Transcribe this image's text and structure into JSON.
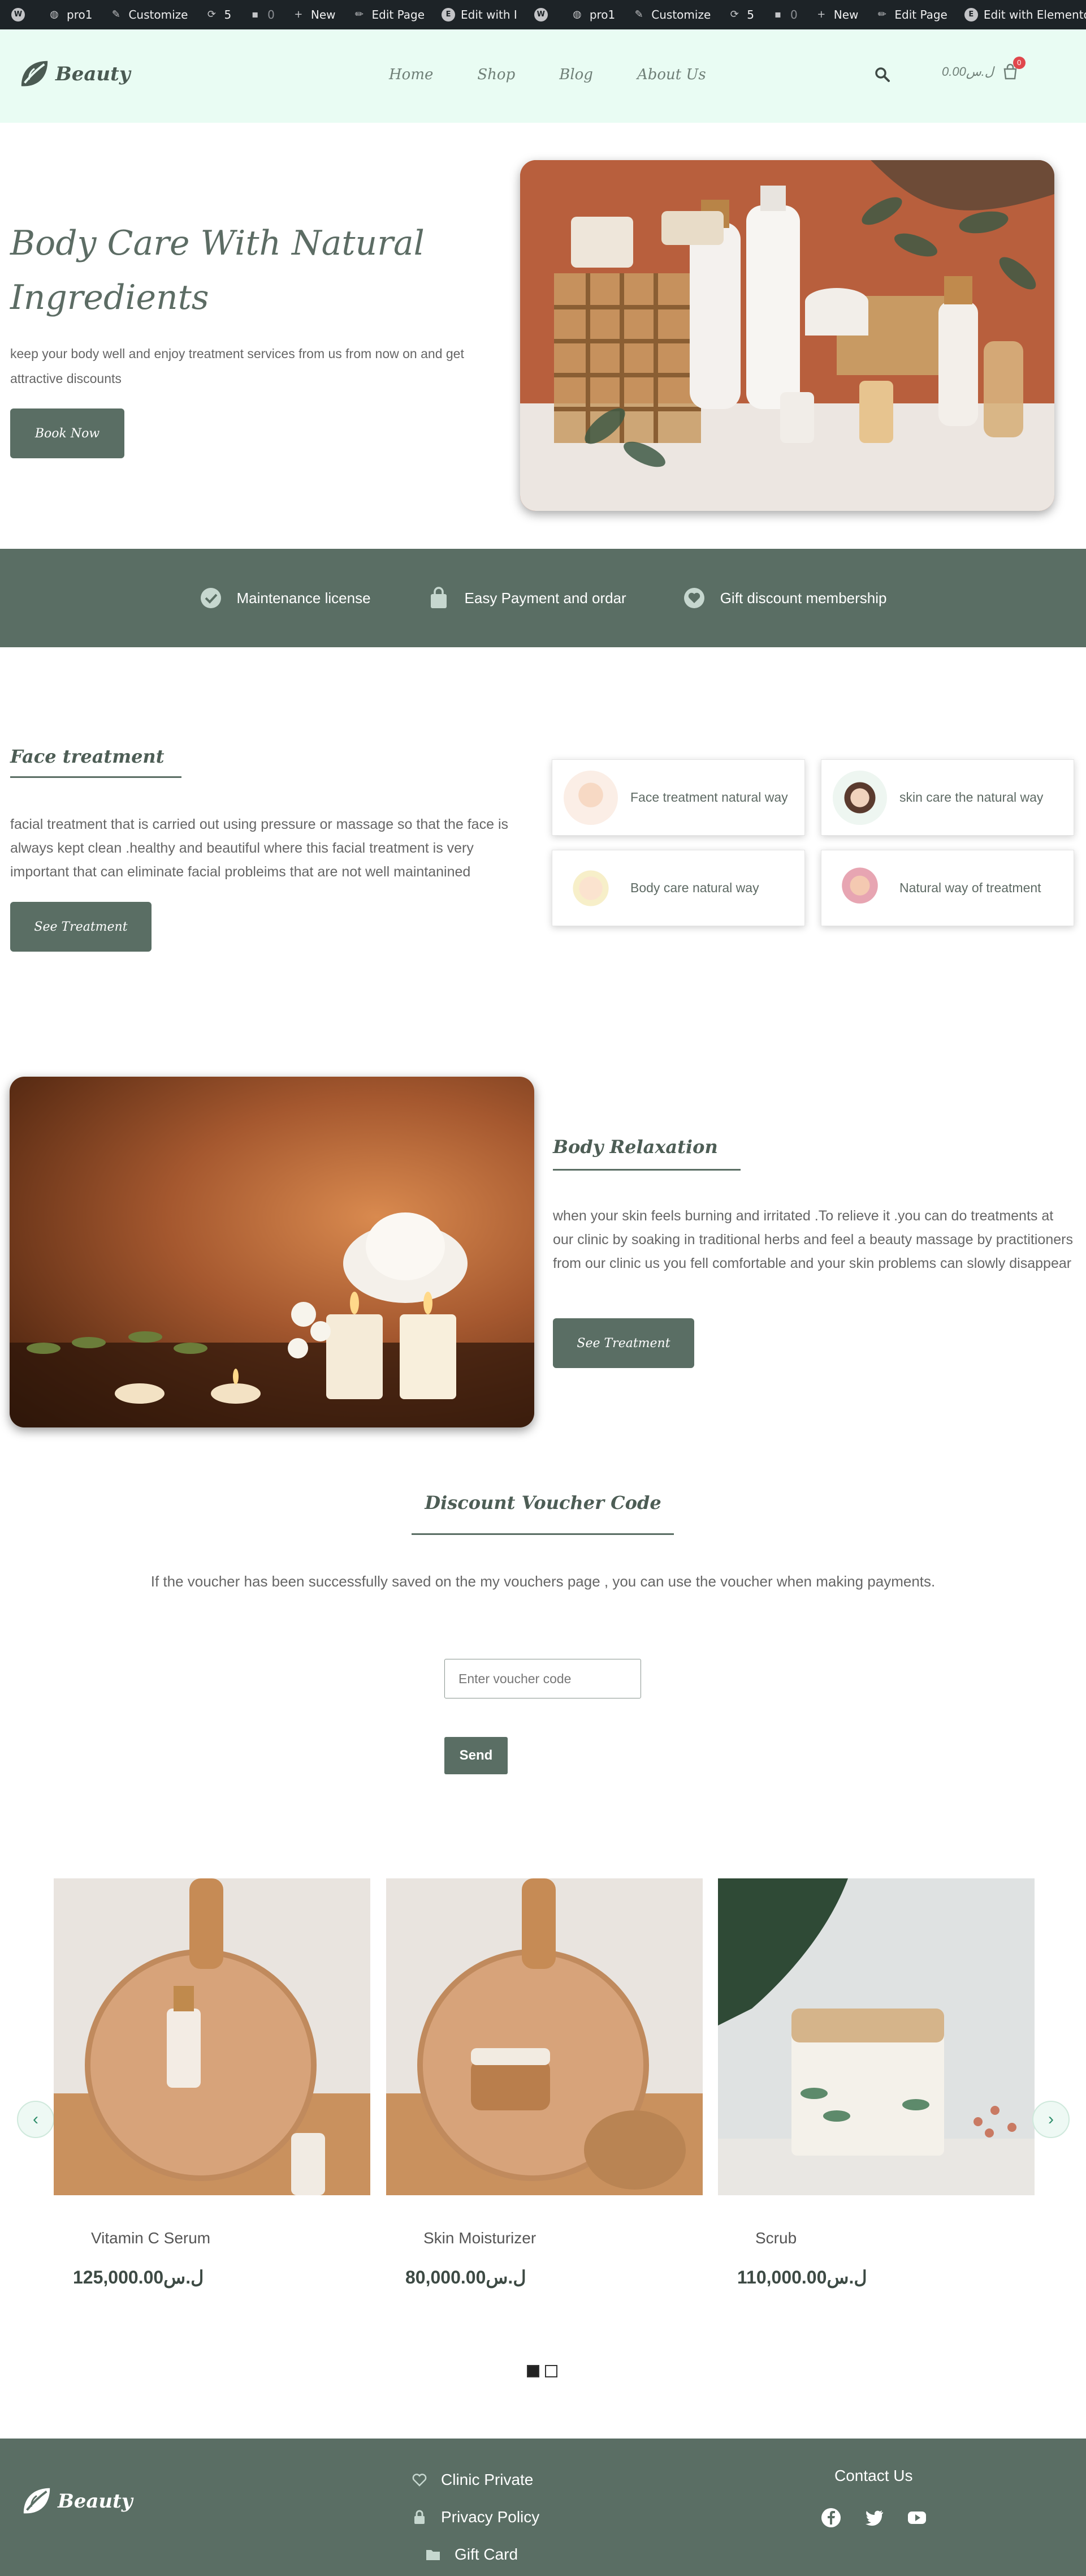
{
  "admin_bar": {
    "items": [
      {
        "icon": "wordpress-icon",
        "label": ""
      },
      {
        "icon": "dashboard-icon",
        "label": "pro1"
      },
      {
        "icon": "brush-icon",
        "label": "Customize"
      },
      {
        "icon": "updates-icon",
        "label": "5"
      },
      {
        "icon": "comment-icon",
        "label": "0"
      },
      {
        "icon": "plus-icon",
        "label": "New"
      },
      {
        "icon": "pencil-icon",
        "label": "Edit Page"
      },
      {
        "icon": "elementor-icon",
        "label": "Edit with I"
      },
      {
        "icon": "wordpress-icon",
        "label": ""
      },
      {
        "icon": "dashboard-icon",
        "label": "pro1"
      },
      {
        "icon": "brush-icon",
        "label": "Customize"
      },
      {
        "icon": "updates-icon",
        "label": "5"
      },
      {
        "icon": "comment-icon",
        "label": "0"
      },
      {
        "icon": "plus-icon",
        "label": "New"
      },
      {
        "icon": "pencil-icon",
        "label": "Edit Page"
      },
      {
        "icon": "elementor-icon",
        "label": "Edit with Elementor"
      }
    ]
  },
  "header": {
    "logo_text": "Beauty",
    "nav": [
      "Home",
      "Shop",
      "Blog",
      "About Us"
    ],
    "cart_amount": "0.00ل.س",
    "cart_count": "0"
  },
  "hero": {
    "title_line1": "Body Care With Natural",
    "title_line2": "Ingredients",
    "text": "keep your body well and enjoy treatment services from us from now on and get attractive discounts",
    "button": "Book Now"
  },
  "features": [
    {
      "icon": "check-circle-icon",
      "label": "Maintenance license"
    },
    {
      "icon": "shopping-bag-icon",
      "label": "Easy Payment and ordar"
    },
    {
      "icon": "heart-circle-icon",
      "label": "Gift discount membership"
    }
  ],
  "face_treatment": {
    "title": "Face treatment",
    "text": "facial treatment that is carried out using pressure or massage so that the face is always kept clean .healthy and beautiful where this facial treatment is very important that can eliminate facial probleims that are not well maintanined",
    "button": "See Treatment",
    "cards": [
      "Face treatment natural way",
      "skin care the natural way",
      "Body care natural way",
      "Natural way of treatment"
    ]
  },
  "body_relaxation": {
    "title": "Body Relaxation",
    "text": "when your skin feels burning and irritated .To relieve it .you can do treatments at our clinic by soaking in traditional herbs and feel a beauty massage by practitioners from our clinic us you fell comfortable and your skin problems can slowly disappear",
    "button": "See Treatment"
  },
  "voucher": {
    "title": "Discount Voucher Code",
    "text": "If the voucher has been successfully saved on the my vouchers page , you can use the voucher when making payments.",
    "placeholder": "Enter voucher code",
    "button": "Send"
  },
  "products": [
    {
      "name": "Vitamin C Serum",
      "price": "125,000.00ل.س"
    },
    {
      "name": "Skin Moisturizer",
      "price": "80,000.00ل.س"
    },
    {
      "name": "Scrub",
      "price": "110,000.00ل.س"
    }
  ],
  "carousel": {
    "prev": "‹",
    "next": "›"
  },
  "footer": {
    "logo_text": "Beauty",
    "links": [
      {
        "icon": "heart-icon",
        "label": "Clinic Private"
      },
      {
        "icon": "lock-icon",
        "label": "Privacy Policy"
      },
      {
        "icon": "folder-icon",
        "label": "Gift Card"
      }
    ],
    "contact_title": "Contact Us",
    "socials": [
      "facebook-icon",
      "twitter-icon",
      "youtube-icon"
    ]
  },
  "colors": {
    "primary": "#5a6e64",
    "header_bg": "#e9fcf3",
    "admin_bar": "#1d2327",
    "badge": "#e0474c"
  }
}
